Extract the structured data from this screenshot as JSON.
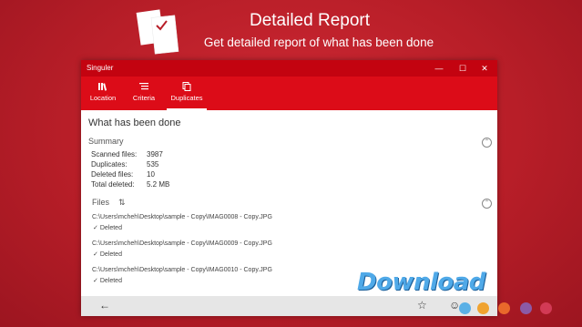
{
  "hero": {
    "title": "Detailed Report",
    "subtitle": "Get detailed report of what has been done",
    "icon": "report-check-icon"
  },
  "window": {
    "title": "Singuler",
    "controls": [
      "minimize-icon",
      "maximize-icon",
      "close-icon"
    ]
  },
  "tabs": [
    {
      "label": "Location",
      "icon": "library-icon",
      "active": false
    },
    {
      "label": "Criteria",
      "icon": "list-icon",
      "active": false
    },
    {
      "label": "Duplicates",
      "icon": "copy-icon",
      "active": true
    }
  ],
  "content": {
    "heading": "What has been done",
    "summary": {
      "label": "Summary",
      "stats": [
        {
          "key": "Scanned files:",
          "value": "3987"
        },
        {
          "key": "Duplicates:",
          "value": "535"
        },
        {
          "key": "Deleted files:",
          "value": "10"
        },
        {
          "key": "Total deleted:",
          "value": "5.2 MB"
        }
      ]
    },
    "files": {
      "label": "Files",
      "items": [
        {
          "path": "C:\\Users\\mcheh\\Desktop\\sample - Copy\\IMAG0008 - Copy.JPG",
          "status": "Deleted"
        },
        {
          "path": "C:\\Users\\mcheh\\Desktop\\sample - Copy\\IMAG0009 - Copy.JPG",
          "status": "Deleted"
        },
        {
          "path": "C:\\Users\\mcheh\\Desktop\\sample - Copy\\IMAG0010 - Copy.JPG",
          "status": "Deleted"
        }
      ]
    }
  },
  "bottombar": {
    "icons": [
      "back-arrow-icon",
      "star-icon",
      "smiley-icon"
    ]
  },
  "watermark": {
    "text": "Download",
    "dots": [
      "#5ab0e6",
      "#f0a330",
      "#e9682b",
      "#8b5aa6",
      "#d23a55"
    ]
  },
  "colors": {
    "background": "#b81e28",
    "titlebar": "#c30310",
    "ribbon": "#dc0c18"
  }
}
